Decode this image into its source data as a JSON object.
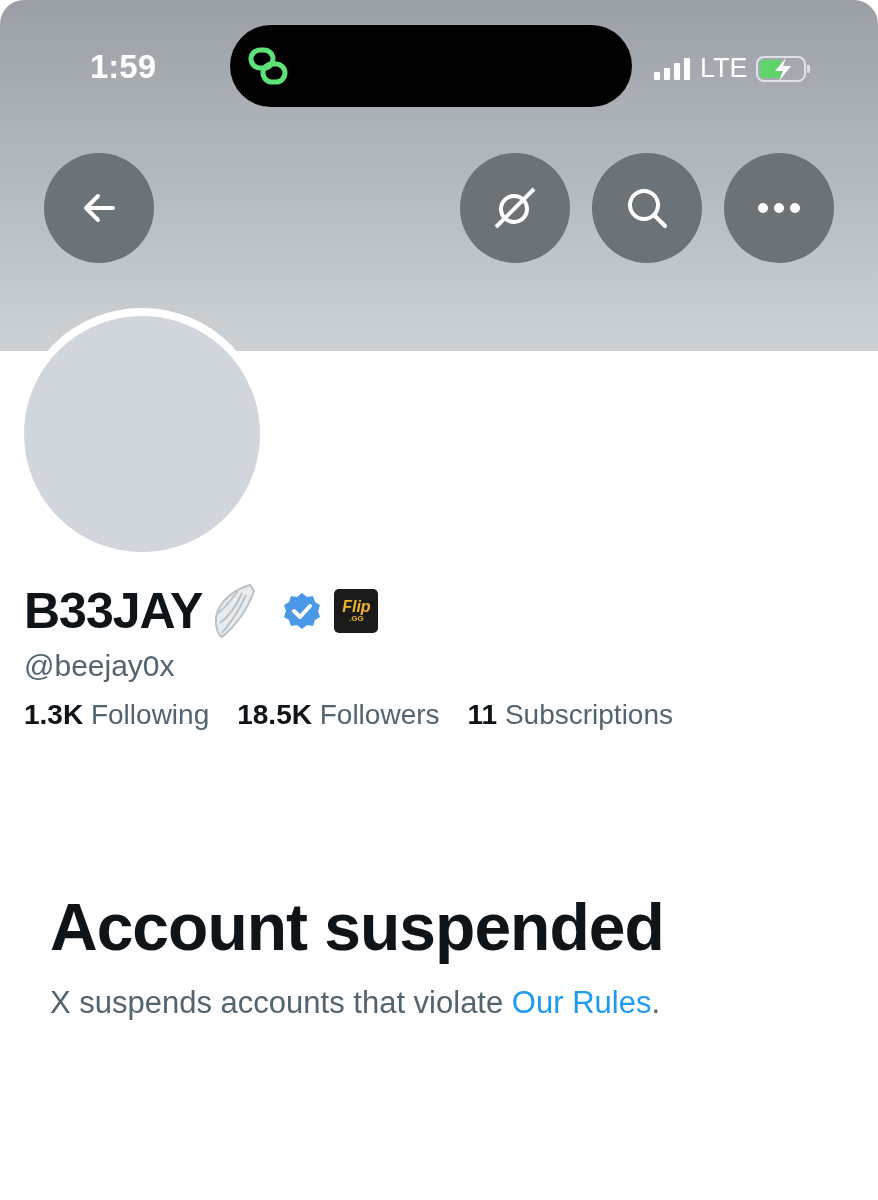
{
  "status_bar": {
    "time": "1:59",
    "network": "LTE"
  },
  "profile": {
    "name": "B33JAY",
    "verified": true,
    "affiliate_badge": {
      "title": "Flip",
      "subtitle": ".GG"
    },
    "handle": "@beejay0x",
    "stats": [
      {
        "count": "1.3K",
        "label": "Following"
      },
      {
        "count": "18.5K",
        "label": "Followers"
      },
      {
        "count": "11",
        "label": "Subscriptions"
      }
    ]
  },
  "notice": {
    "title": "Account suspended",
    "text": "X suspends accounts that violate ",
    "link": "Our Rules",
    "end": "."
  }
}
